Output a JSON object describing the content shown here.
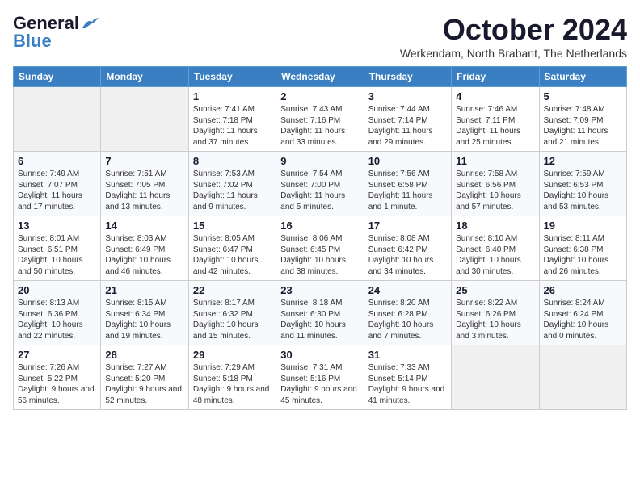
{
  "header": {
    "logo_line1": "General",
    "logo_line2": "Blue",
    "month_title": "October 2024",
    "subtitle": "Werkendam, North Brabant, The Netherlands"
  },
  "weekdays": [
    "Sunday",
    "Monday",
    "Tuesday",
    "Wednesday",
    "Thursday",
    "Friday",
    "Saturday"
  ],
  "weeks": [
    [
      {
        "day": "",
        "content": ""
      },
      {
        "day": "",
        "content": ""
      },
      {
        "day": "1",
        "content": "Sunrise: 7:41 AM\nSunset: 7:18 PM\nDaylight: 11 hours and 37 minutes."
      },
      {
        "day": "2",
        "content": "Sunrise: 7:43 AM\nSunset: 7:16 PM\nDaylight: 11 hours and 33 minutes."
      },
      {
        "day": "3",
        "content": "Sunrise: 7:44 AM\nSunset: 7:14 PM\nDaylight: 11 hours and 29 minutes."
      },
      {
        "day": "4",
        "content": "Sunrise: 7:46 AM\nSunset: 7:11 PM\nDaylight: 11 hours and 25 minutes."
      },
      {
        "day": "5",
        "content": "Sunrise: 7:48 AM\nSunset: 7:09 PM\nDaylight: 11 hours and 21 minutes."
      }
    ],
    [
      {
        "day": "6",
        "content": "Sunrise: 7:49 AM\nSunset: 7:07 PM\nDaylight: 11 hours and 17 minutes."
      },
      {
        "day": "7",
        "content": "Sunrise: 7:51 AM\nSunset: 7:05 PM\nDaylight: 11 hours and 13 minutes."
      },
      {
        "day": "8",
        "content": "Sunrise: 7:53 AM\nSunset: 7:02 PM\nDaylight: 11 hours and 9 minutes."
      },
      {
        "day": "9",
        "content": "Sunrise: 7:54 AM\nSunset: 7:00 PM\nDaylight: 11 hours and 5 minutes."
      },
      {
        "day": "10",
        "content": "Sunrise: 7:56 AM\nSunset: 6:58 PM\nDaylight: 11 hours and 1 minute."
      },
      {
        "day": "11",
        "content": "Sunrise: 7:58 AM\nSunset: 6:56 PM\nDaylight: 10 hours and 57 minutes."
      },
      {
        "day": "12",
        "content": "Sunrise: 7:59 AM\nSunset: 6:53 PM\nDaylight: 10 hours and 53 minutes."
      }
    ],
    [
      {
        "day": "13",
        "content": "Sunrise: 8:01 AM\nSunset: 6:51 PM\nDaylight: 10 hours and 50 minutes."
      },
      {
        "day": "14",
        "content": "Sunrise: 8:03 AM\nSunset: 6:49 PM\nDaylight: 10 hours and 46 minutes."
      },
      {
        "day": "15",
        "content": "Sunrise: 8:05 AM\nSunset: 6:47 PM\nDaylight: 10 hours and 42 minutes."
      },
      {
        "day": "16",
        "content": "Sunrise: 8:06 AM\nSunset: 6:45 PM\nDaylight: 10 hours and 38 minutes."
      },
      {
        "day": "17",
        "content": "Sunrise: 8:08 AM\nSunset: 6:42 PM\nDaylight: 10 hours and 34 minutes."
      },
      {
        "day": "18",
        "content": "Sunrise: 8:10 AM\nSunset: 6:40 PM\nDaylight: 10 hours and 30 minutes."
      },
      {
        "day": "19",
        "content": "Sunrise: 8:11 AM\nSunset: 6:38 PM\nDaylight: 10 hours and 26 minutes."
      }
    ],
    [
      {
        "day": "20",
        "content": "Sunrise: 8:13 AM\nSunset: 6:36 PM\nDaylight: 10 hours and 22 minutes."
      },
      {
        "day": "21",
        "content": "Sunrise: 8:15 AM\nSunset: 6:34 PM\nDaylight: 10 hours and 19 minutes."
      },
      {
        "day": "22",
        "content": "Sunrise: 8:17 AM\nSunset: 6:32 PM\nDaylight: 10 hours and 15 minutes."
      },
      {
        "day": "23",
        "content": "Sunrise: 8:18 AM\nSunset: 6:30 PM\nDaylight: 10 hours and 11 minutes."
      },
      {
        "day": "24",
        "content": "Sunrise: 8:20 AM\nSunset: 6:28 PM\nDaylight: 10 hours and 7 minutes."
      },
      {
        "day": "25",
        "content": "Sunrise: 8:22 AM\nSunset: 6:26 PM\nDaylight: 10 hours and 3 minutes."
      },
      {
        "day": "26",
        "content": "Sunrise: 8:24 AM\nSunset: 6:24 PM\nDaylight: 10 hours and 0 minutes."
      }
    ],
    [
      {
        "day": "27",
        "content": "Sunrise: 7:26 AM\nSunset: 5:22 PM\nDaylight: 9 hours and 56 minutes."
      },
      {
        "day": "28",
        "content": "Sunrise: 7:27 AM\nSunset: 5:20 PM\nDaylight: 9 hours and 52 minutes."
      },
      {
        "day": "29",
        "content": "Sunrise: 7:29 AM\nSunset: 5:18 PM\nDaylight: 9 hours and 48 minutes."
      },
      {
        "day": "30",
        "content": "Sunrise: 7:31 AM\nSunset: 5:16 PM\nDaylight: 9 hours and 45 minutes."
      },
      {
        "day": "31",
        "content": "Sunrise: 7:33 AM\nSunset: 5:14 PM\nDaylight: 9 hours and 41 minutes."
      },
      {
        "day": "",
        "content": ""
      },
      {
        "day": "",
        "content": ""
      }
    ]
  ]
}
